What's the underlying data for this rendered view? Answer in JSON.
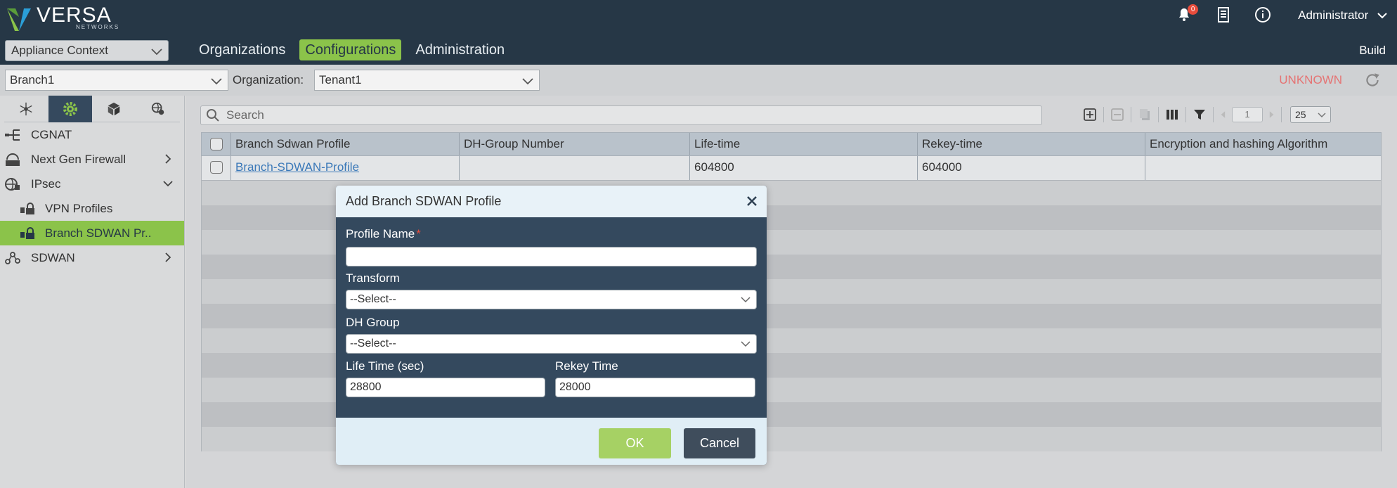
{
  "app": {
    "logo_text": "VERSA",
    "logo_sub": "NETWORKS",
    "notifications_count": "0",
    "user": "Administrator",
    "context_select": "Appliance Context",
    "build_label": "Build"
  },
  "nav": {
    "tabs": [
      {
        "label": "Organizations"
      },
      {
        "label": "Configurations"
      },
      {
        "label": "Administration"
      }
    ]
  },
  "context": {
    "appliance": "Branch1",
    "org_label": "Organization:",
    "org_value": "Tenant1",
    "status": "UNKNOWN"
  },
  "sidebar": {
    "items": [
      {
        "label": "CGNAT"
      },
      {
        "label": "Next Gen Firewall"
      },
      {
        "label": "IPsec"
      },
      {
        "label": "VPN Profiles"
      },
      {
        "label": "Branch SDWAN Pr.."
      },
      {
        "label": "SDWAN"
      }
    ]
  },
  "search": {
    "placeholder": "Search"
  },
  "pager": {
    "page": "1",
    "per_page": "25"
  },
  "table": {
    "headers": [
      "Branch Sdwan Profile",
      "DH-Group Number",
      "Life-time",
      "Rekey-time",
      "Encryption and hashing Algorithm"
    ],
    "rows": [
      {
        "profile": "Branch-SDWAN-Profile",
        "dh_group": "",
        "lifetime": "604800",
        "rekey": "604000",
        "encryption": ""
      }
    ]
  },
  "modal": {
    "title": "Add Branch SDWAN Profile",
    "profile_name_label": "Profile Name",
    "required_mark": "*",
    "profile_name_value": "",
    "transform_label": "Transform",
    "transform_value": "--Select--",
    "dh_group_label": "DH Group",
    "dh_group_value": "--Select--",
    "lifetime_label": "Life Time (sec)",
    "lifetime_value": "28800",
    "rekey_label": "Rekey Time",
    "rekey_value": "28000",
    "ok_label": "OK",
    "cancel_label": "Cancel"
  },
  "colors": {
    "header_bg": "#263746",
    "accent_green": "#8bc34a",
    "modal_bg": "#34495e",
    "link": "#3a78b8",
    "status_red": "#e57373"
  }
}
